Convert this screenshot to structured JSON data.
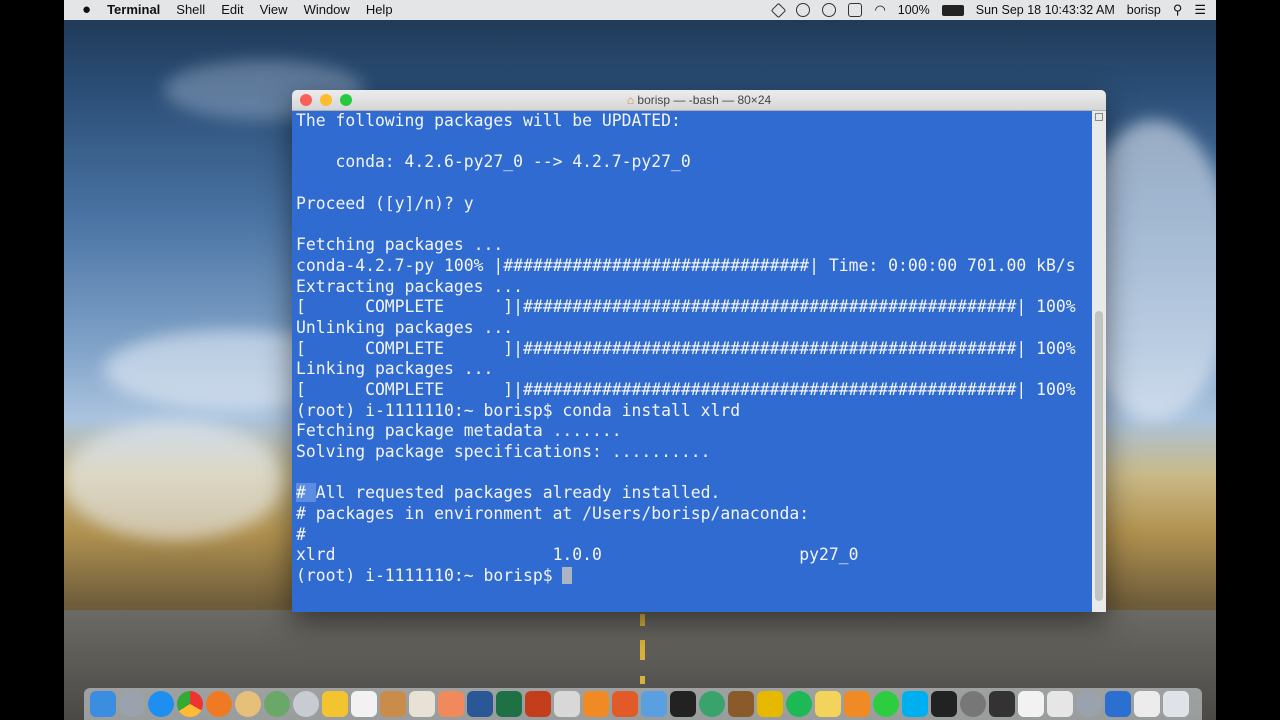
{
  "menubar": {
    "apple": "",
    "app_name": "Terminal",
    "items": [
      "Shell",
      "Edit",
      "View",
      "Window",
      "Help"
    ],
    "battery": "100%",
    "datetime": "Sun Sep 18  10:43:32 AM",
    "user": "borisp"
  },
  "window": {
    "title": "borisp — -bash — 80×24"
  },
  "terminal": {
    "lines": [
      "The following packages will be UPDATED:",
      "",
      "    conda: 4.2.6-py27_0 --> 4.2.7-py27_0",
      "",
      "Proceed ([y]/n)? y",
      "",
      "Fetching packages ...",
      "conda-4.2.7-py 100% |###############################| Time: 0:00:00 701.00 kB/s",
      "Extracting packages ...",
      "[      COMPLETE      ]|##################################################| 100%",
      "Unlinking packages ...",
      "[      COMPLETE      ]|##################################################| 100%",
      "Linking packages ...",
      "[      COMPLETE      ]|##################################################| 100%",
      "(root) i-1111110:~ borisp$ conda install xlrd",
      "Fetching package metadata .......",
      "Solving package specifications: ..........",
      "",
      "# All requested packages already installed.",
      "# packages in environment at /Users/borisp/anaconda:",
      "#",
      "xlrd                      1.0.0                    py27_0",
      "(root) i-1111110:~ borisp$ "
    ]
  },
  "colors": {
    "terminal_bg": "#2f6bd1",
    "terminal_fg": "#f4f4f4",
    "close": "#fc5f57",
    "minimize": "#fdbc2e",
    "zoom": "#28c840"
  }
}
